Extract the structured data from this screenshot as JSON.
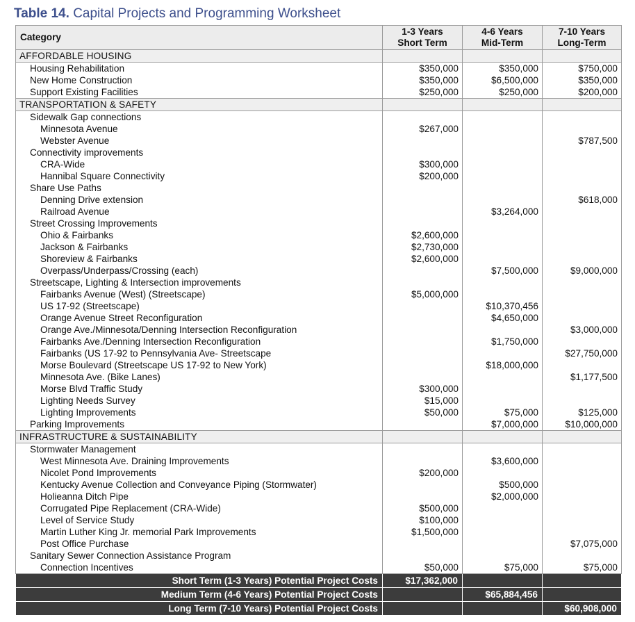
{
  "title": {
    "label": "Table 14.",
    "text": "Capital Projects and Programming Worksheet"
  },
  "headers": {
    "category": "Category",
    "short_line1": "1-3 Years",
    "short_line2": "Short Term",
    "mid_line1": "4-6 Years",
    "mid_line2": "Mid-Term",
    "long_line1": "7-10 Years",
    "long_line2": "Long-Term"
  },
  "rows": [
    {
      "type": "section",
      "label": "AFFORDABLE HOUSING",
      "s": "",
      "m": "",
      "l": ""
    },
    {
      "type": "item",
      "indent": 1,
      "label": "Housing Rehabilitation",
      "s": "$350,000",
      "m": "$350,000",
      "l": "$750,000",
      "first": true
    },
    {
      "type": "item",
      "indent": 1,
      "label": "New Home Construction",
      "s": "$350,000",
      "m": "$6,500,000",
      "l": "$350,000"
    },
    {
      "type": "item",
      "indent": 1,
      "label": "Support Existing Facilities",
      "s": "$250,000",
      "m": "$250,000",
      "l": "$200,000"
    },
    {
      "type": "section",
      "label": "TRANSPORTATION & SAFETY",
      "s": "",
      "m": "",
      "l": ""
    },
    {
      "type": "item",
      "indent": 1,
      "label": "Sidewalk Gap connections",
      "s": "",
      "m": "",
      "l": "",
      "first": true
    },
    {
      "type": "item",
      "indent": 2,
      "label": "Minnesota Avenue",
      "s": "$267,000",
      "m": "",
      "l": ""
    },
    {
      "type": "item",
      "indent": 2,
      "label": "Webster Avenue",
      "s": "",
      "m": "",
      "l": "$787,500"
    },
    {
      "type": "item",
      "indent": 1,
      "label": "Connectivity improvements",
      "s": "",
      "m": "",
      "l": ""
    },
    {
      "type": "item",
      "indent": 2,
      "label": "CRA-Wide",
      "s": "$300,000",
      "m": "",
      "l": ""
    },
    {
      "type": "item",
      "indent": 2,
      "label": "Hannibal Square Connectivity",
      "s": "$200,000",
      "m": "",
      "l": ""
    },
    {
      "type": "item",
      "indent": 1,
      "label": "Share Use Paths",
      "s": "",
      "m": "",
      "l": ""
    },
    {
      "type": "item",
      "indent": 2,
      "label": "Denning Drive extension",
      "s": "",
      "m": "",
      "l": "$618,000"
    },
    {
      "type": "item",
      "indent": 2,
      "label": "Railroad Avenue",
      "s": "",
      "m": "$3,264,000",
      "l": ""
    },
    {
      "type": "item",
      "indent": 1,
      "label": "Street Crossing Improvements",
      "s": "",
      "m": "",
      "l": ""
    },
    {
      "type": "item",
      "indent": 2,
      "label": "Ohio & Fairbanks",
      "s": "$2,600,000",
      "m": "",
      "l": ""
    },
    {
      "type": "item",
      "indent": 2,
      "label": "Jackson & Fairbanks",
      "s": "$2,730,000",
      "m": "",
      "l": ""
    },
    {
      "type": "item",
      "indent": 2,
      "label": "Shoreview & Fairbanks",
      "s": "$2,600,000",
      "m": "",
      "l": ""
    },
    {
      "type": "item",
      "indent": 2,
      "label": "Overpass/Underpass/Crossing (each)",
      "s": "",
      "m": "$7,500,000",
      "l": "$9,000,000"
    },
    {
      "type": "item",
      "indent": 1,
      "label": "Streetscape, Lighting & Intersection improvements",
      "s": "",
      "m": "",
      "l": ""
    },
    {
      "type": "item",
      "indent": 2,
      "label": "Fairbanks Avenue (West) (Streetscape)",
      "s": "$5,000,000",
      "m": "",
      "l": ""
    },
    {
      "type": "item",
      "indent": 2,
      "label": "US 17-92 (Streetscape)",
      "s": "",
      "m": "$10,370,456",
      "l": ""
    },
    {
      "type": "item",
      "indent": 2,
      "label": "Orange Avenue Street Reconfiguration",
      "s": "",
      "m": "$4,650,000",
      "l": ""
    },
    {
      "type": "item",
      "indent": 2,
      "label": "Orange Ave./Minnesota/Denning Intersection Reconfiguration",
      "s": "",
      "m": "",
      "l": "$3,000,000"
    },
    {
      "type": "item",
      "indent": 2,
      "label": "Fairbanks Ave./Denning Intersection Reconfiguration",
      "s": "",
      "m": "$1,750,000",
      "l": ""
    },
    {
      "type": "item",
      "indent": 2,
      "label": "Fairbanks (US 17-92 to Pennsylvania Ave- Streetscape",
      "s": "",
      "m": "",
      "l": "$27,750,000"
    },
    {
      "type": "item",
      "indent": 2,
      "label": "Morse Boulevard (Streetscape US 17-92 to New York)",
      "s": "",
      "m": "$18,000,000",
      "l": ""
    },
    {
      "type": "item",
      "indent": 2,
      "label": "Minnesota Ave. (Bike Lanes)",
      "s": "",
      "m": "",
      "l": "$1,177,500"
    },
    {
      "type": "item",
      "indent": 2,
      "label": "Morse Blvd Traffic Study",
      "s": "$300,000",
      "m": "",
      "l": ""
    },
    {
      "type": "item",
      "indent": 2,
      "label": "Lighting Needs Survey",
      "s": "$15,000",
      "m": "",
      "l": ""
    },
    {
      "type": "item",
      "indent": 2,
      "label": "Lighting Improvements",
      "s": "$50,000",
      "m": "$75,000",
      "l": "$125,000"
    },
    {
      "type": "item",
      "indent": 1,
      "label": "Parking Improvements",
      "s": "",
      "m": "$7,000,000",
      "l": "$10,000,000"
    },
    {
      "type": "section",
      "label": "INFRASTRUCTURE & SUSTAINABILITY",
      "s": "",
      "m": "",
      "l": ""
    },
    {
      "type": "item",
      "indent": 1,
      "label": "Stormwater Management",
      "s": "",
      "m": "",
      "l": "",
      "first": true
    },
    {
      "type": "item",
      "indent": 2,
      "label": "West Minnesota Ave. Draining Improvements",
      "s": "",
      "m": "$3,600,000",
      "l": ""
    },
    {
      "type": "item",
      "indent": 2,
      "label": "Nicolet Pond Improvements",
      "s": "$200,000",
      "m": "",
      "l": ""
    },
    {
      "type": "item",
      "indent": 2,
      "label": "Kentucky Avenue Collection and Conveyance Piping (Stormwater)",
      "s": "",
      "m": "$500,000",
      "l": ""
    },
    {
      "type": "item",
      "indent": 2,
      "label": "Holieanna Ditch Pipe",
      "s": "",
      "m": "$2,000,000",
      "l": ""
    },
    {
      "type": "item",
      "indent": 2,
      "label": "Corrugated Pipe Replacement (CRA-Wide)",
      "s": "$500,000",
      "m": "",
      "l": ""
    },
    {
      "type": "item",
      "indent": 2,
      "label": "Level of Service Study",
      "s": "$100,000",
      "m": "",
      "l": ""
    },
    {
      "type": "item",
      "indent": 2,
      "label": "Martin Luther King Jr. memorial Park Improvements",
      "s": "$1,500,000",
      "m": "",
      "l": ""
    },
    {
      "type": "item",
      "indent": 2,
      "label": "Post Office Purchase",
      "s": "",
      "m": "",
      "l": "$7,075,000"
    },
    {
      "type": "item",
      "indent": 1,
      "label": "Sanitary Sewer Connection Assistance Program",
      "s": "",
      "m": "",
      "l": ""
    },
    {
      "type": "item",
      "indent": 2,
      "label": "Connection Incentives",
      "s": "$50,000",
      "m": "$75,000",
      "l": "$75,000",
      "last": true
    }
  ],
  "totals": [
    {
      "label": "Short Term (1-3 Years) Potential Project Costs",
      "s": "$17,362,000",
      "m": "",
      "l": ""
    },
    {
      "label": "Medium Term (4-6 Years) Potential Project Costs",
      "s": "",
      "m": "$65,884,456",
      "l": ""
    },
    {
      "label": "Long Term (7-10 Years) Potential Project Costs",
      "s": "",
      "m": "",
      "l": "$60,908,000"
    }
  ]
}
